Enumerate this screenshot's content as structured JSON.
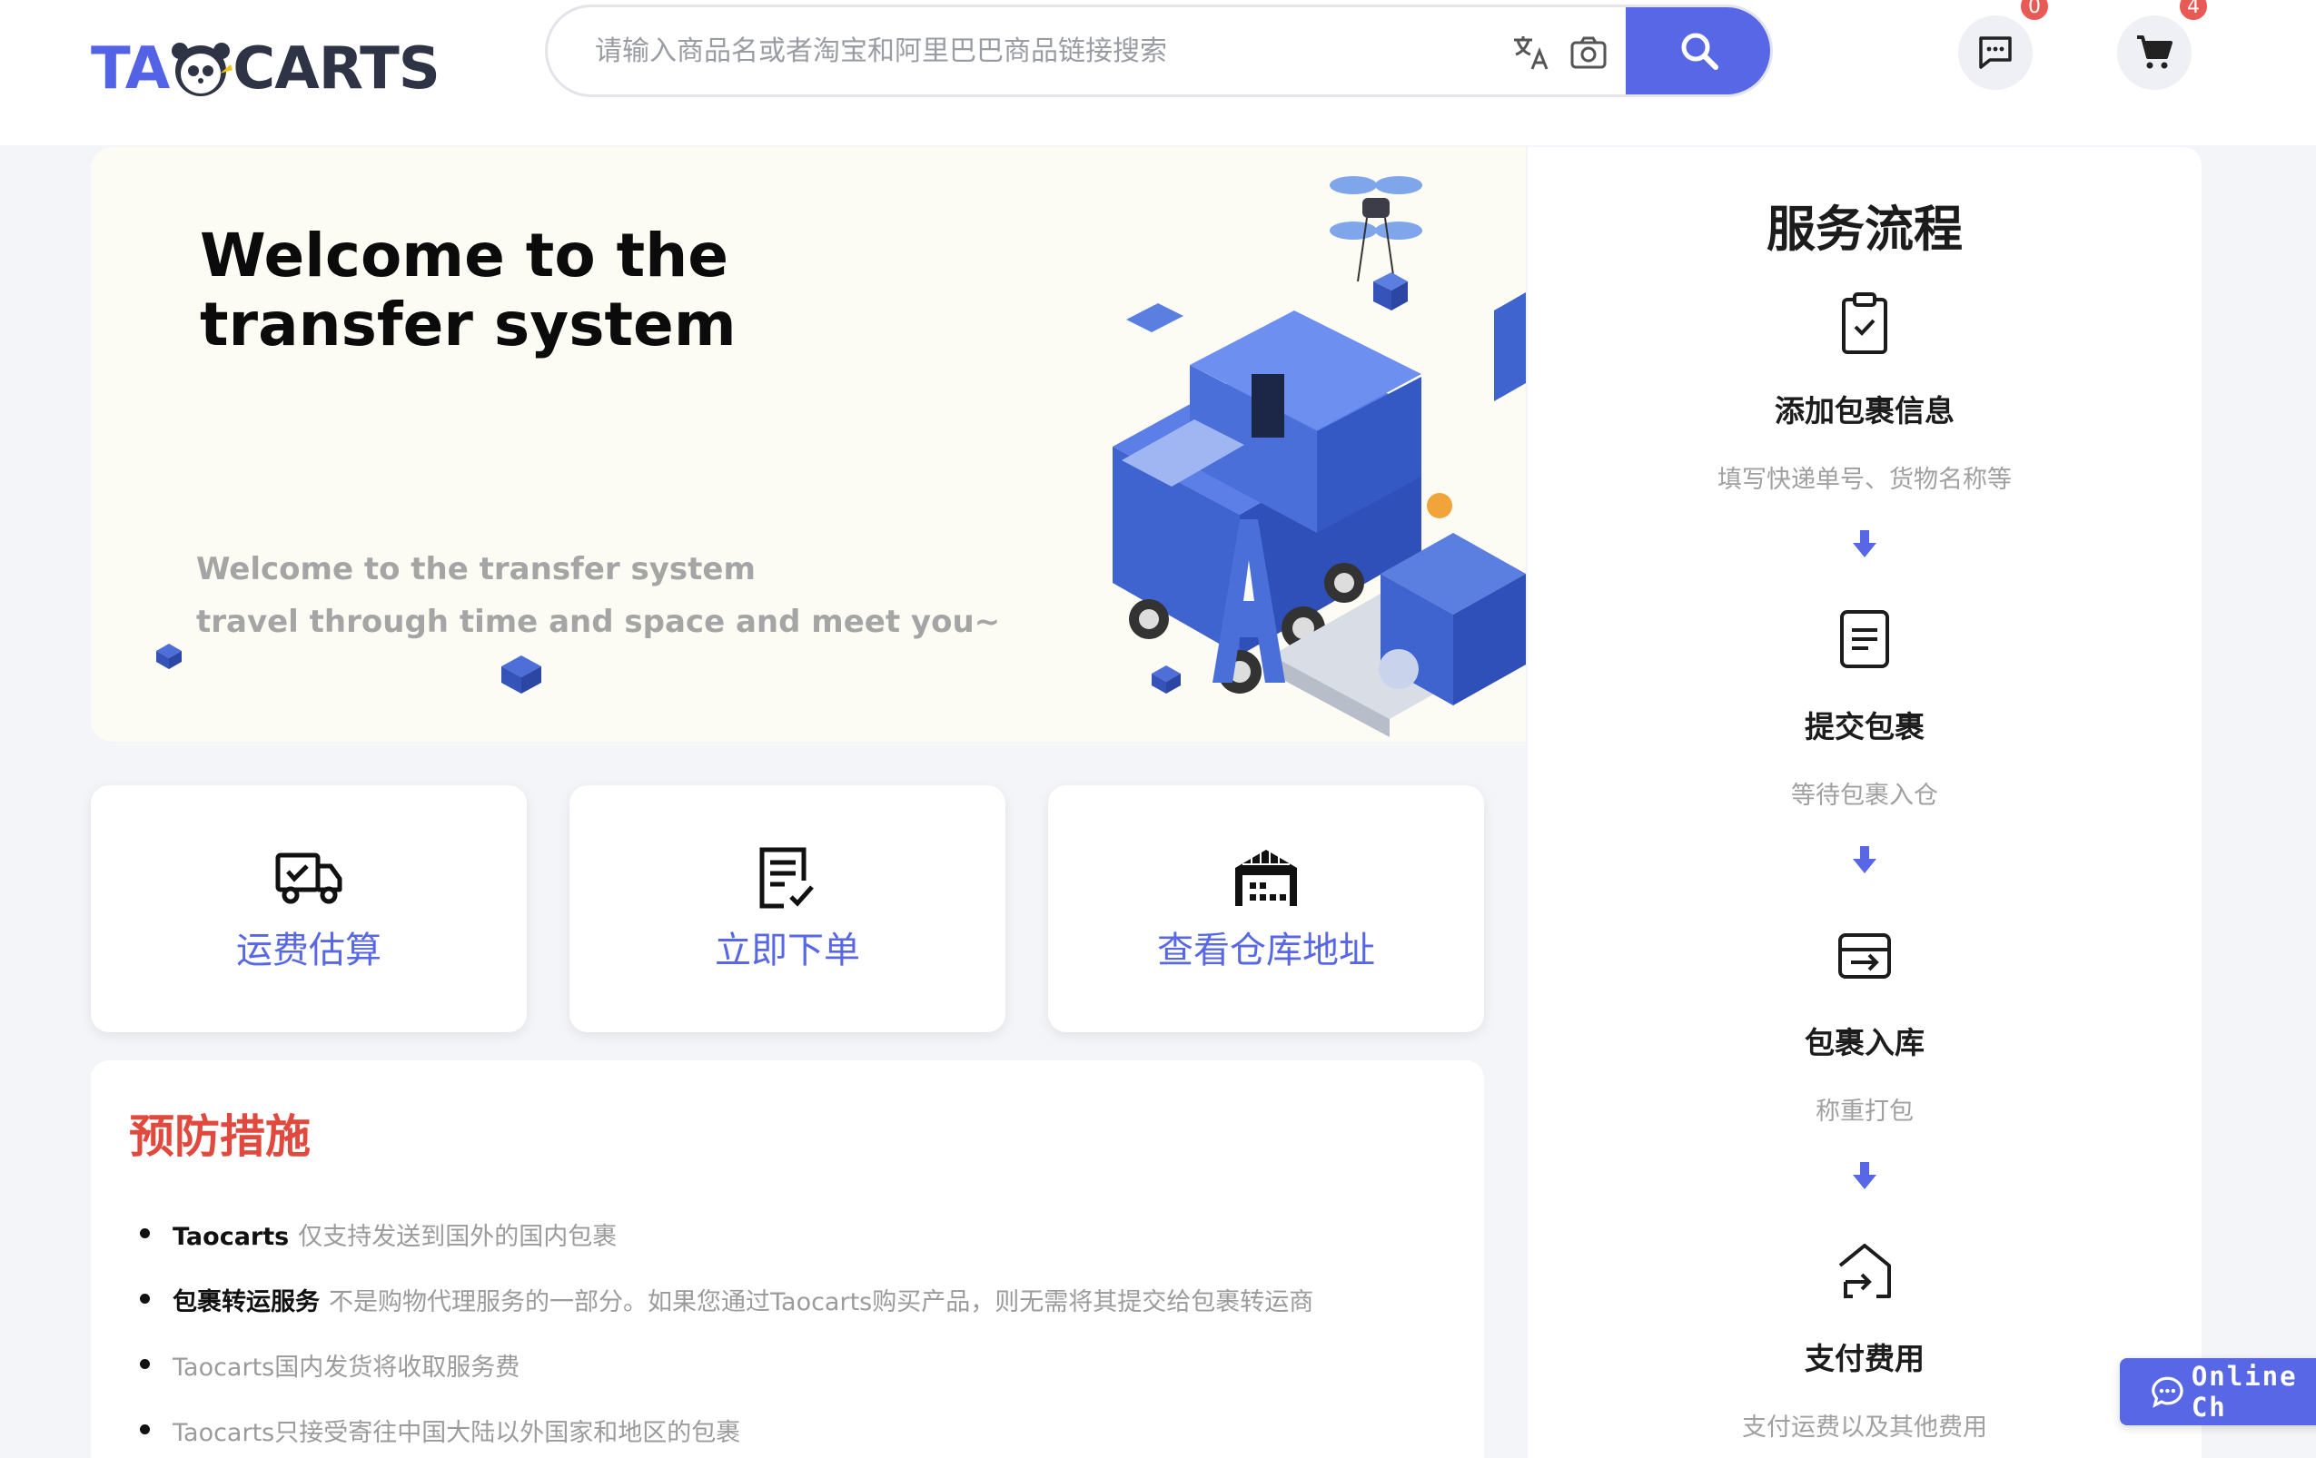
{
  "header": {
    "logo_left": "TA",
    "logo_right": "CARTS",
    "search_placeholder": "请输入商品名或者淘宝和阿里巴巴商品链接搜索",
    "messages_count": "0",
    "cart_count": "4"
  },
  "banner": {
    "title": "Welcome to the transfer system",
    "subtitle_1": "Welcome to the transfer system",
    "subtitle_2": "travel through time and space and meet you~"
  },
  "actions": [
    {
      "label": "运费估算",
      "icon": "truck-check-icon"
    },
    {
      "label": "立即下单",
      "icon": "order-edit-icon"
    },
    {
      "label": "查看仓库地址",
      "icon": "warehouse-icon"
    }
  ],
  "precautions": {
    "title": "预防措施",
    "items": [
      {
        "bold": "Taocarts",
        "text": "仅支持发送到国外的国内包裹"
      },
      {
        "bold": "包裹转运服务",
        "text": "不是购物代理服务的一部分。如果您通过Taocarts购买产品，则无需将其提交给包裹转运商"
      },
      {
        "bold": "",
        "text": "Taocarts国内发货将收取服务费"
      },
      {
        "bold": "",
        "text": "Taocarts只接受寄往中国大陆以外国家和地区的包裹"
      }
    ]
  },
  "service_flow": {
    "title": "服务流程",
    "steps": [
      {
        "title": "添加包裹信息",
        "desc": "填写快递单号、货物名称等",
        "icon": "clipboard-check-icon"
      },
      {
        "title": "提交包裹",
        "desc": "等待包裹入仓",
        "icon": "document-icon"
      },
      {
        "title": "包裹入库",
        "desc": "称重打包",
        "icon": "inbox-arrow-icon"
      },
      {
        "title": "支付费用",
        "desc": "支付运费以及其他费用",
        "icon": "payment-return-icon"
      }
    ]
  },
  "chat": {
    "label": "Online Ch"
  },
  "colors": {
    "accent": "#5867e6",
    "warning_title": "#e2493e",
    "badge": "#e85a55"
  }
}
